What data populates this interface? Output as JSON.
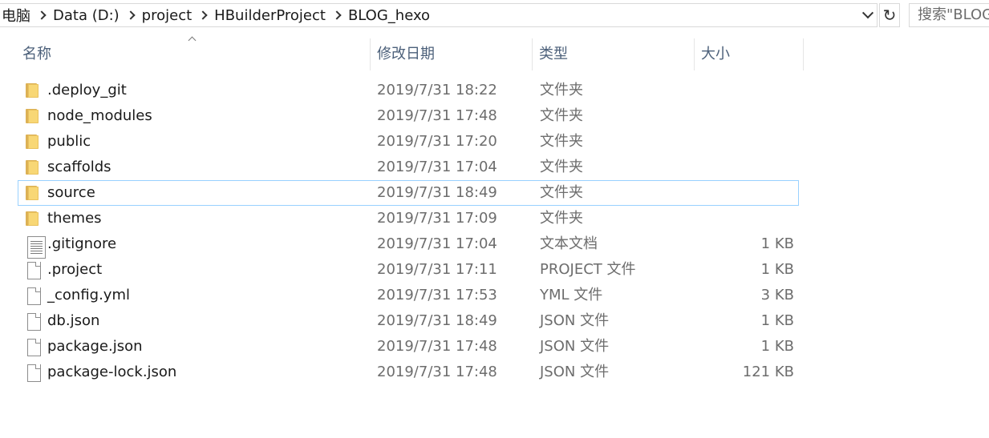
{
  "address_bar": {
    "crumbs": [
      "电脑",
      "Data (D:)",
      "project",
      "HBuilderProject",
      "BLOG_hexo"
    ],
    "refresh_icon": "↻",
    "search_placeholder": "搜索\"BLOG_hexo\""
  },
  "columns": {
    "name": "名称",
    "date": "修改日期",
    "type": "类型",
    "size": "大小"
  },
  "files": [
    {
      "name": ".deploy_git",
      "date": "2019/7/31 18:22",
      "type": "文件夹",
      "size": "",
      "icon": "folder-icon"
    },
    {
      "name": "node_modules",
      "date": "2019/7/31 17:48",
      "type": "文件夹",
      "size": "",
      "icon": "folder-icon"
    },
    {
      "name": "public",
      "date": "2019/7/31 17:20",
      "type": "文件夹",
      "size": "",
      "icon": "folder-icon"
    },
    {
      "name": "scaffolds",
      "date": "2019/7/31 17:04",
      "type": "文件夹",
      "size": "",
      "icon": "folder-icon"
    },
    {
      "name": "source",
      "date": "2019/7/31 18:49",
      "type": "文件夹",
      "size": "",
      "icon": "folder-icon",
      "selected": true
    },
    {
      "name": "themes",
      "date": "2019/7/31 17:09",
      "type": "文件夹",
      "size": "",
      "icon": "folder-icon"
    },
    {
      "name": ".gitignore",
      "date": "2019/7/31 17:04",
      "type": "文本文档",
      "size": "1 KB",
      "icon": "text-file-icon"
    },
    {
      "name": ".project",
      "date": "2019/7/31 17:11",
      "type": "PROJECT 文件",
      "size": "1 KB",
      "icon": "file-icon"
    },
    {
      "name": "_config.yml",
      "date": "2019/7/31 17:53",
      "type": "YML 文件",
      "size": "3 KB",
      "icon": "file-icon"
    },
    {
      "name": "db.json",
      "date": "2019/7/31 18:49",
      "type": "JSON 文件",
      "size": "1 KB",
      "icon": "file-icon"
    },
    {
      "name": "package.json",
      "date": "2019/7/31 17:48",
      "type": "JSON 文件",
      "size": "1 KB",
      "icon": "file-icon"
    },
    {
      "name": "package-lock.json",
      "date": "2019/7/31 17:48",
      "type": "JSON 文件",
      "size": "121 KB",
      "icon": "file-icon"
    }
  ]
}
